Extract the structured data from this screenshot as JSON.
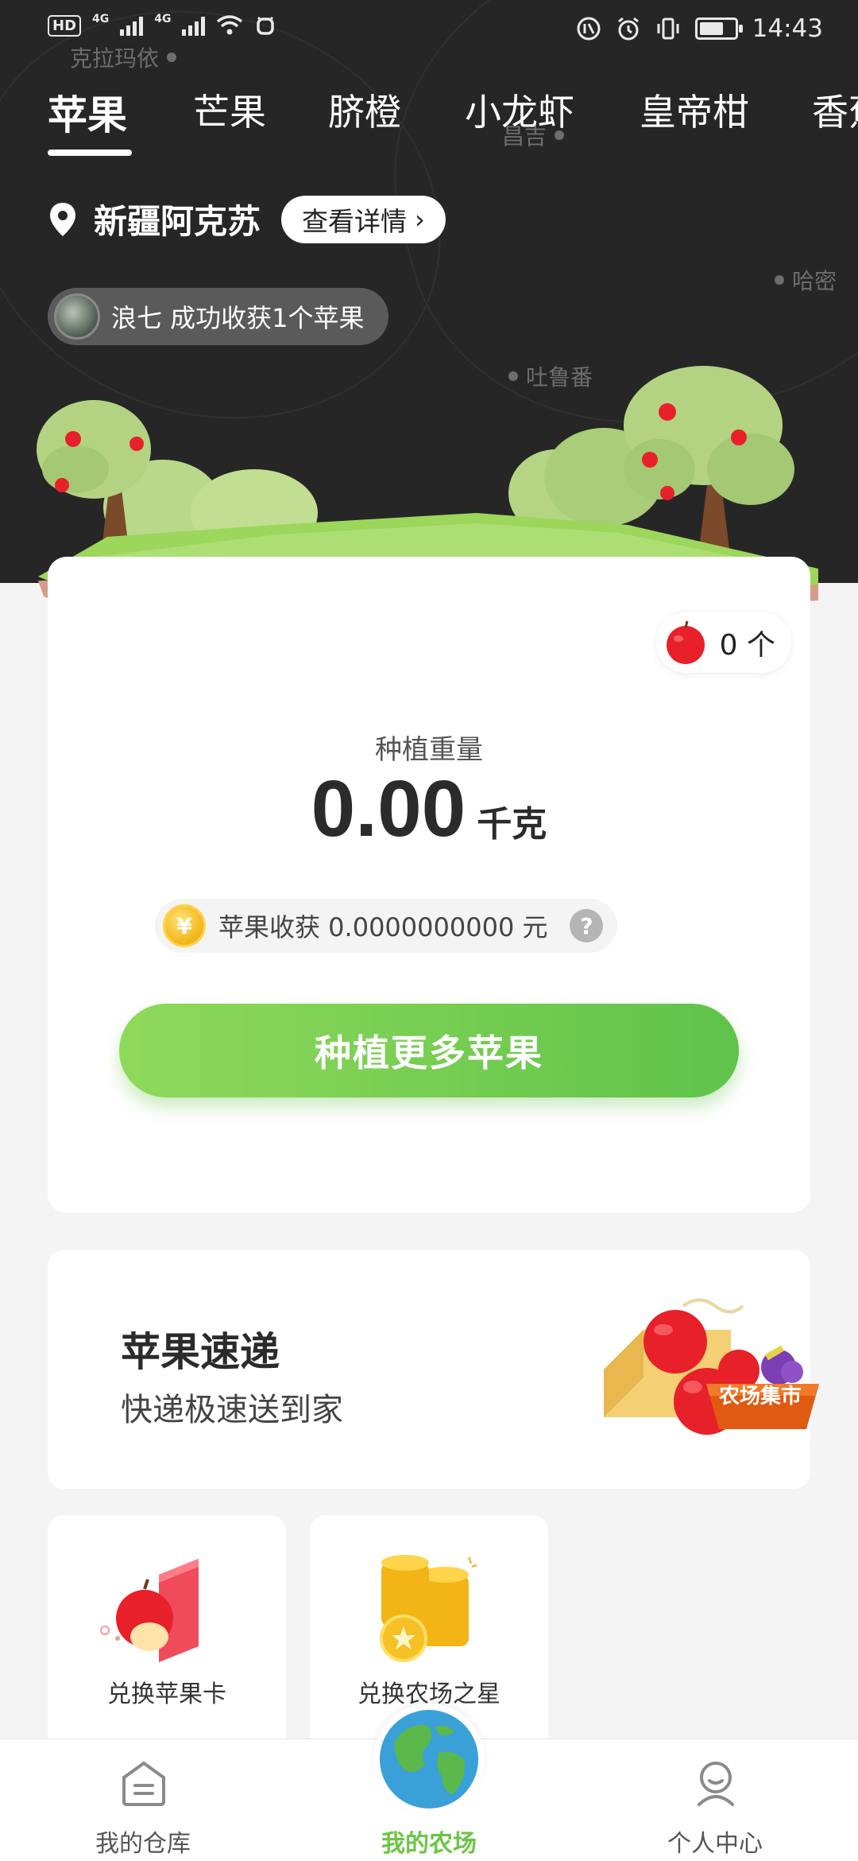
{
  "status_bar": {
    "left_badge": "HD",
    "signal_1": "4G",
    "signal_2": "4G",
    "time": "14:43",
    "battery_level": 0.7
  },
  "map_labels": [
    "克拉玛依",
    "昌吉",
    "哈密",
    "吐鲁番"
  ],
  "tabs": [
    {
      "label": "苹果",
      "active": true
    },
    {
      "label": "芒果",
      "active": false
    },
    {
      "label": "脐橙",
      "active": false
    },
    {
      "label": "小龙虾",
      "active": false
    },
    {
      "label": "皇帝柑",
      "active": false
    },
    {
      "label": "香蕉",
      "active": false
    }
  ],
  "location": {
    "name": "新疆阿克苏",
    "detail_button": "查看详情"
  },
  "harvest_notice": "浪七 成功收获1个苹果",
  "farm": {
    "apple_count": "0 个",
    "weight_label": "种植重量",
    "weight_value": "0.00",
    "weight_unit": "千克",
    "income_text": "苹果收获 0.0000000000 元",
    "coin_symbol": "¥",
    "help_symbol": "?",
    "cta_label": "种植更多苹果"
  },
  "express": {
    "title": "苹果速递",
    "subtitle": "快递极速送到家",
    "market_badge": "农场集市"
  },
  "tiles": [
    {
      "label": "兑换苹果卡",
      "icon": "apple-card-icon"
    },
    {
      "label": "兑换农场之星",
      "icon": "gold-coins-icon"
    }
  ],
  "bottom_nav": [
    {
      "label": "我的仓库",
      "icon": "warehouse-icon",
      "active": false
    },
    {
      "label": "我的农场",
      "icon": "globe-icon",
      "active": true
    },
    {
      "label": "个人中心",
      "icon": "profile-icon",
      "active": false
    }
  ],
  "colors": {
    "accent_green": "#6cc544",
    "header_bg": "#262626",
    "apple_red": "#e8202a"
  }
}
